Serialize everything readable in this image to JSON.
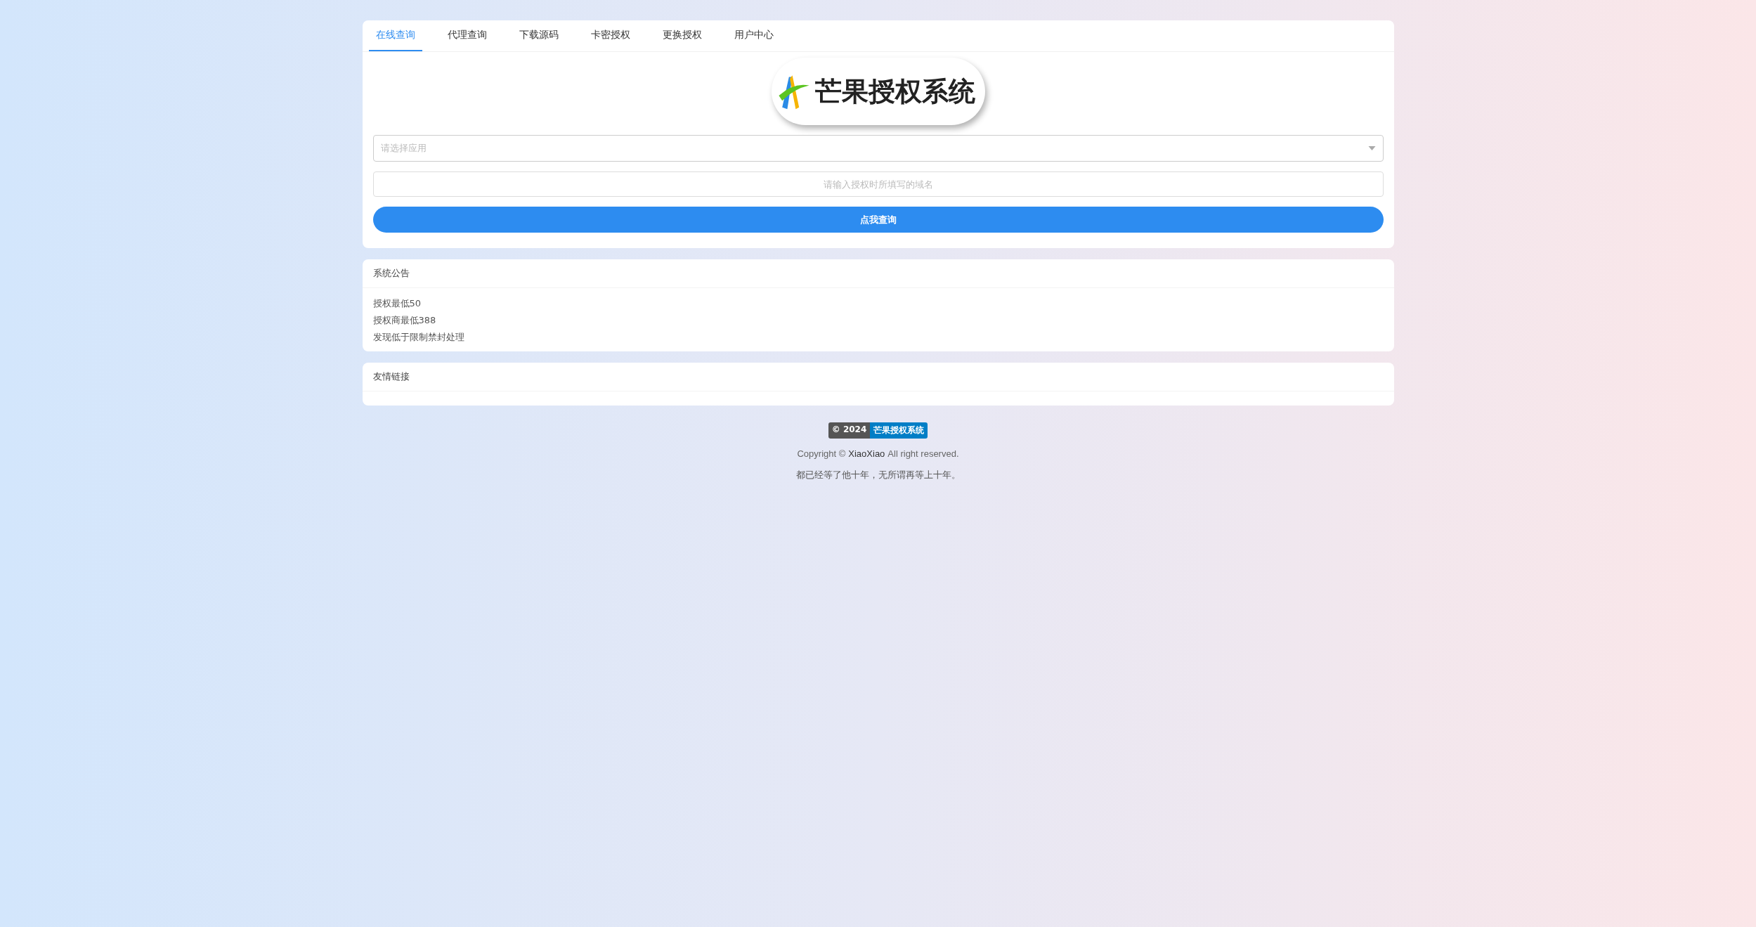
{
  "tabs": [
    {
      "label": "在线查询",
      "selected": true
    },
    {
      "label": "代理查询",
      "selected": false
    },
    {
      "label": "下载源码",
      "selected": false
    },
    {
      "label": "卡密授权",
      "selected": false
    },
    {
      "label": "更换授权",
      "selected": false
    },
    {
      "label": "用户中心",
      "selected": false
    }
  ],
  "logo": {
    "text": "芒果授权系统"
  },
  "select": {
    "placeholder": "请选择应用"
  },
  "domain": {
    "placeholder": "请输入授权时所填写的域名"
  },
  "query_button": "点我查询",
  "announcement": {
    "title": "系统公告",
    "lines": [
      "授权最低50",
      "授权商最低388",
      "发现低于限制禁封处理"
    ]
  },
  "links": {
    "title": "友情链接"
  },
  "footer": {
    "badge_left": "© 2024",
    "badge_right": "芒果授权系统",
    "copyright_prefix": "Copyright ©",
    "copyright_name": "XiaoXiao",
    "copyright_suffix": "All right reserved.",
    "motto": "都已经等了他十年，无所谓再等上十年。"
  }
}
